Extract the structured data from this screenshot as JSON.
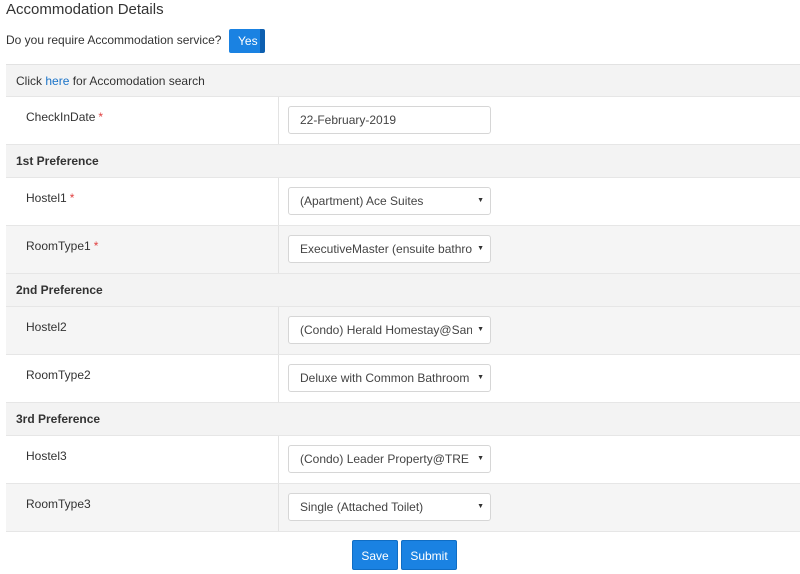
{
  "section_title": "Accommodation Details",
  "require_question": "Do you require Accommodation service?",
  "require_toggle": "Yes",
  "search_prompt": {
    "prefix": "Click ",
    "link": "here",
    "suffix": " for Accomodation search"
  },
  "checkin": {
    "label": "CheckInDate",
    "required_mark": "*",
    "value": "22-February-2019"
  },
  "preferences": [
    {
      "title": "1st Preference",
      "hostel": {
        "label": "Hostel1",
        "required_mark": "*",
        "value": "(Apartment) Ace Suites"
      },
      "room": {
        "label": "RoomType1",
        "required_mark": "*",
        "value": "ExecutiveMaster (ensuite bathroom)"
      }
    },
    {
      "title": "2nd Preference",
      "hostel": {
        "label": "Hostel2",
        "value": "(Condo) Herald Homestay@Santa"
      },
      "room": {
        "label": "RoomType2",
        "value": "Deluxe with Common Bathroom"
      }
    },
    {
      "title": "3rd Preference",
      "hostel": {
        "label": "Hostel3",
        "value": "(Condo) Leader Property@TRE Residences"
      },
      "room": {
        "label": "RoomType3",
        "value": "Single (Attached Toilet)"
      }
    }
  ],
  "buttons": {
    "save": "Save",
    "submit": "Submit"
  },
  "icons": {
    "dropdown": "caret-down-icon"
  },
  "colors": {
    "primary": "#1a82e2",
    "required": "#e04040",
    "link": "#1a73c8"
  }
}
